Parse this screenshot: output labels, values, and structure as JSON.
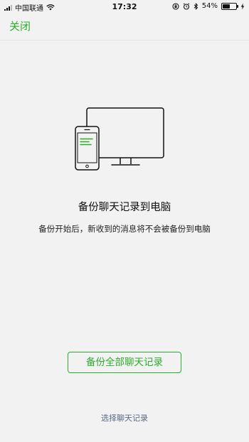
{
  "status_bar": {
    "carrier": "中国联通",
    "time": "17:32",
    "battery_percent": "54%",
    "battery_level": 0.54,
    "icons": [
      "signal-icon",
      "wifi-icon",
      "lock-rotation-icon",
      "alarm-icon",
      "bluetooth-icon",
      "battery-icon",
      "charging-icon"
    ]
  },
  "nav": {
    "close_label": "关闭"
  },
  "illustration": {
    "icon": "phone-to-computer-icon"
  },
  "main": {
    "title": "备份聊天记录到电脑",
    "description": "备份开始后，新收到的消息将不会被备份到电脑"
  },
  "actions": {
    "backup_all_label": "备份全部聊天记录",
    "select_chats_label": "选择聊天记录"
  },
  "colors": {
    "accent": "#2aae2a",
    "link": "#596a8a",
    "background": "#f2f2f2"
  }
}
